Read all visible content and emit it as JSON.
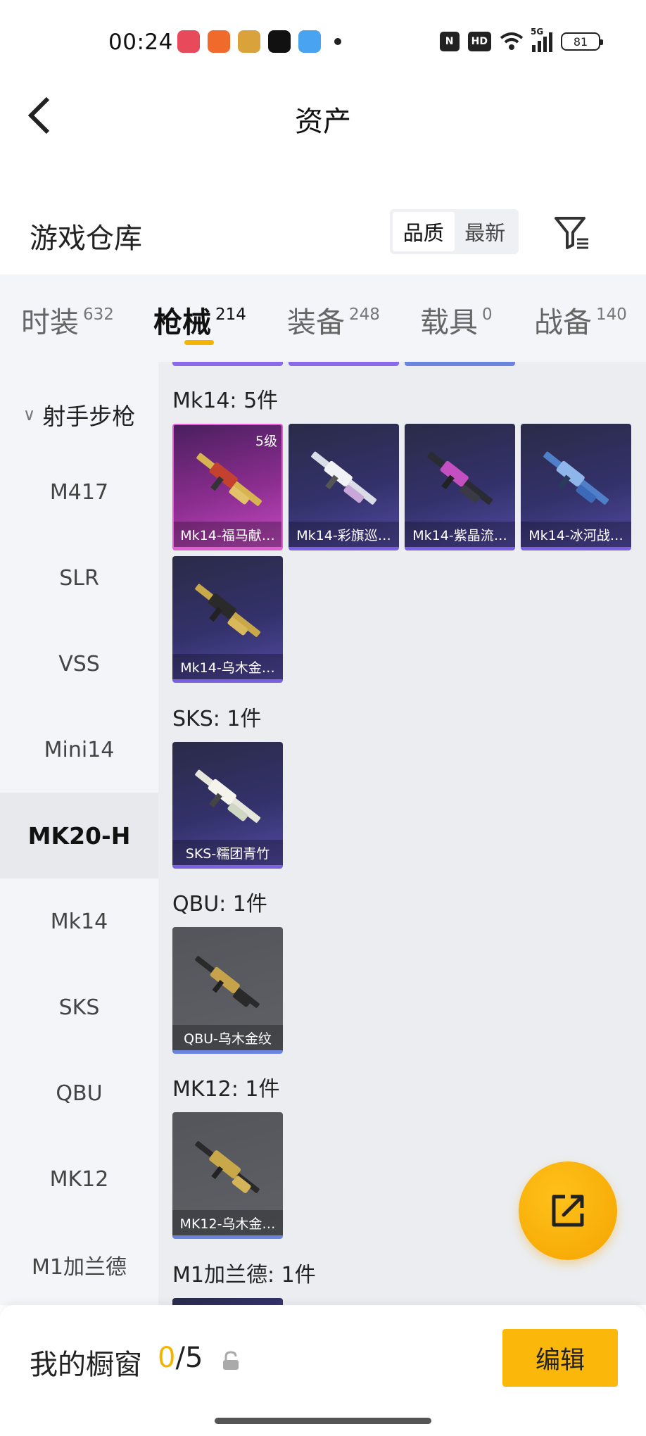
{
  "status_bar": {
    "time": "00:24",
    "indicators": [
      "N",
      "HD"
    ],
    "network": "5G",
    "battery": "81",
    "app_colors": [
      "#e8495b",
      "#f06a2c",
      "#d9a23a",
      "#111111",
      "#4aa3f0"
    ]
  },
  "nav": {
    "title": "资产"
  },
  "warehouse": {
    "title": "游戏仓库",
    "sort_options": [
      "品质",
      "最新"
    ],
    "active_sort": "品质"
  },
  "tabs": [
    {
      "label": "时装",
      "count": "632"
    },
    {
      "label": "枪械",
      "count": "214"
    },
    {
      "label": "装备",
      "count": "248"
    },
    {
      "label": "载具",
      "count": "0"
    },
    {
      "label": "战备",
      "count": "140"
    }
  ],
  "sidebar": {
    "group": "射手步枪",
    "items": [
      "M417",
      "SLR",
      "VSS",
      "Mini14",
      "MK20-H",
      "Mk14",
      "SKS",
      "QBU",
      "MK12",
      "M1加兰德"
    ],
    "active": "MK20-H"
  },
  "sections": [
    {
      "title": "Mk14: 5件",
      "items": [
        {
          "name": "Mk14-福马献…",
          "level": "5级",
          "tier": "pink"
        },
        {
          "name": "Mk14-彩旗巡…",
          "tier": "purple"
        },
        {
          "name": "Mk14-紫晶流…",
          "tier": "purple"
        },
        {
          "name": "Mk14-冰河战…",
          "tier": "purple"
        },
        {
          "name": "Mk14-乌木金…",
          "tier": "purple"
        }
      ]
    },
    {
      "title": "SKS: 1件",
      "items": [
        {
          "name": "SKS-糯团青竹",
          "tier": "purple"
        }
      ]
    },
    {
      "title": "QBU: 1件",
      "items": [
        {
          "name": "QBU-乌木金纹",
          "tier": "gray"
        }
      ]
    },
    {
      "title": "MK12: 1件",
      "items": [
        {
          "name": "MK12-乌木金…",
          "tier": "gray"
        }
      ]
    },
    {
      "title": "M1加兰德: 1件",
      "items": []
    }
  ],
  "showcase": {
    "label": "我的橱窗",
    "current": "0",
    "separator": "/",
    "max": "5",
    "edit_label": "编辑"
  },
  "colors": {
    "accent": "#f5b400",
    "purple_tier": "#7b61e0",
    "pink_tier": "#e060d0"
  }
}
